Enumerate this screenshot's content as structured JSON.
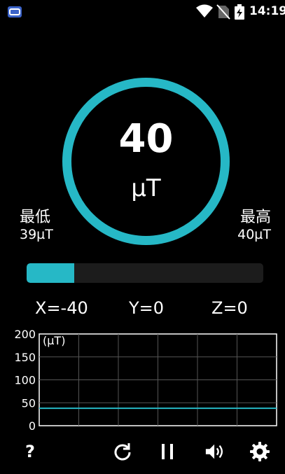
{
  "status_bar": {
    "time": "14:19",
    "icons": [
      "app-icon",
      "wifi-icon",
      "no-sim-icon",
      "battery-charging-icon"
    ]
  },
  "gauge": {
    "value": "40",
    "unit": "µT",
    "level_fraction": 0.2,
    "ring_color": "#26b8c6"
  },
  "min": {
    "label": "最低",
    "value": "39µT"
  },
  "max": {
    "label": "最高",
    "value": "40µT"
  },
  "axes": {
    "x": "X=-40",
    "y": "Y=0",
    "z": "Z=0"
  },
  "chart_data": {
    "type": "line",
    "title": "",
    "xlabel": "",
    "ylabel": "(µT)",
    "ylim": [
      0,
      200
    ],
    "yticks": [
      0,
      50,
      100,
      150,
      200
    ],
    "grid": true,
    "series": [
      {
        "values": [
          38,
          38,
          38,
          38,
          38,
          38,
          38,
          38,
          38,
          38,
          38,
          38,
          38,
          38,
          38,
          38,
          38,
          38,
          38,
          38,
          38,
          38,
          38,
          38,
          38,
          38,
          38,
          38,
          38,
          38
        ],
        "color": "#26b8c6"
      }
    ]
  },
  "toolbar": {
    "help_label": "?",
    "icons": [
      "help-icon",
      "reset-icon",
      "pause-icon",
      "sound-icon",
      "settings-icon"
    ]
  },
  "colors": {
    "accent": "#26b8c6",
    "background": "#000000",
    "track": "#1c1c1c"
  }
}
